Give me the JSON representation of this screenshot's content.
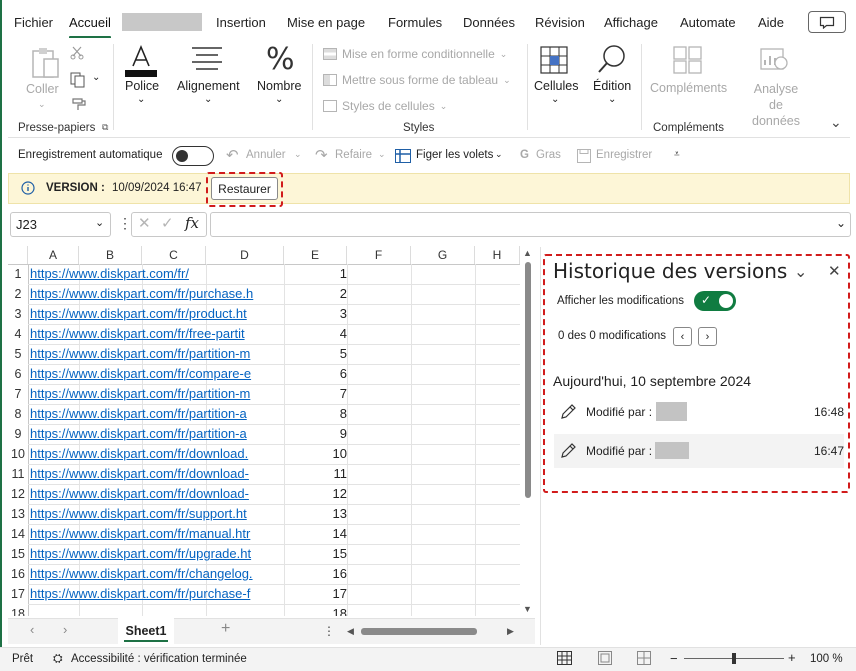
{
  "menu": {
    "tabs": [
      "Fichier",
      "Accueil",
      "Insertion",
      "Mise en page",
      "Formules",
      "Données",
      "Révision",
      "Affichage",
      "Automate",
      "Aide"
    ],
    "active": "Accueil"
  },
  "ribbon": {
    "clipboard": {
      "paste": "Coller",
      "group": "Presse-papiers"
    },
    "font": "Police",
    "alignment": "Alignement",
    "number": "Nombre",
    "styles": {
      "conditional": "Mise en forme conditionnelle",
      "table": "Mettre sous forme de tableau",
      "cell_styles": "Styles de cellules",
      "group": "Styles"
    },
    "cells": "Cellules",
    "edition": "Édition",
    "addins": "Compléments",
    "analyze": "Analyse de données",
    "addins_group": "Compléments"
  },
  "qat": {
    "autosave": "Enregistrement automatique",
    "undo": "Annuler",
    "redo": "Refaire",
    "freeze": "Figer les volets",
    "bold": "Gras",
    "save": "Enregistrer"
  },
  "version_bar": {
    "label": "VERSION :",
    "date": "10/09/2024 16:47",
    "restore": "Restaurer"
  },
  "formula_bar": {
    "cell_ref": "J23",
    "fx": "fx",
    "value": ""
  },
  "grid": {
    "columns": [
      "A",
      "B",
      "C",
      "D",
      "E",
      "F",
      "G",
      "H"
    ],
    "rows": [
      {
        "n": "1",
        "url": "https://www.diskpart.com/fr/",
        "e": "1"
      },
      {
        "n": "2",
        "url": "https://www.diskpart.com/fr/purchase.h",
        "e": "2"
      },
      {
        "n": "3",
        "url": "https://www.diskpart.com/fr/product.ht",
        "e": "3"
      },
      {
        "n": "4",
        "url": "https://www.diskpart.com/fr/free-partit",
        "e": "4"
      },
      {
        "n": "5",
        "url": "https://www.diskpart.com/fr/partition-m",
        "e": "5"
      },
      {
        "n": "6",
        "url": "https://www.diskpart.com/fr/compare-e",
        "e": "6"
      },
      {
        "n": "7",
        "url": "https://www.diskpart.com/fr/partition-m",
        "e": "7"
      },
      {
        "n": "8",
        "url": "https://www.diskpart.com/fr/partition-a",
        "e": "8"
      },
      {
        "n": "9",
        "url": "https://www.diskpart.com/fr/partition-a",
        "e": "9"
      },
      {
        "n": "10",
        "url": "https://www.diskpart.com/fr/download.",
        "e": "10"
      },
      {
        "n": "11",
        "url": "https://www.diskpart.com/fr/download-",
        "e": "11"
      },
      {
        "n": "12",
        "url": "https://www.diskpart.com/fr/download-",
        "e": "12"
      },
      {
        "n": "13",
        "url": "https://www.diskpart.com/fr/support.ht",
        "e": "13"
      },
      {
        "n": "14",
        "url": "https://www.diskpart.com/fr/manual.htr",
        "e": "14"
      },
      {
        "n": "15",
        "url": "https://www.diskpart.com/fr/upgrade.ht",
        "e": "15"
      },
      {
        "n": "16",
        "url": "https://www.diskpart.com/fr/changelog.",
        "e": "16"
      },
      {
        "n": "17",
        "url": "https://www.diskpart.com/fr/purchase-f",
        "e": "17"
      },
      {
        "n": "18",
        "url": "",
        "e": "18"
      }
    ]
  },
  "sheets": {
    "active": "Sheet1"
  },
  "status": {
    "ready": "Prêt",
    "accessibility": "Accessibilité : vérification terminée",
    "zoom": "100 %",
    "zoom_level": 1.0
  },
  "version_panel": {
    "title": "Historique des versions",
    "show_changes": "Afficher les modifications",
    "show_changes_on": true,
    "counter": "0 des 0 modifications",
    "date_heading": "Aujourd'hui, 10 septembre 2024",
    "entries": [
      {
        "label": "Modifié par :",
        "time": "16:48"
      },
      {
        "label": "Modifié par :",
        "time": "16:47"
      }
    ]
  },
  "colors": {
    "accent": "#107c41",
    "link": "#0563c1",
    "highlight": "#d11b1b",
    "version_bar": "#fdf6d7"
  }
}
